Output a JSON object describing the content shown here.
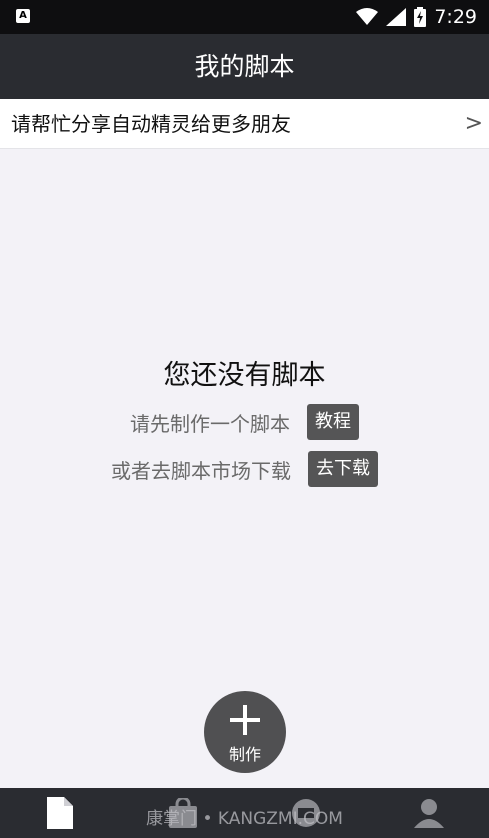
{
  "status_bar": {
    "time": "7:29",
    "app_badge": "A"
  },
  "header": {
    "title": "我的脚本"
  },
  "share_banner": {
    "label": "请帮忙分享自动精灵给更多朋友",
    "chevron": ">"
  },
  "empty_state": {
    "title": "您还没有脚本",
    "line1_text": "请先制作一个脚本",
    "line1_button": "教程",
    "line2_text": "或者去脚本市场下载",
    "line2_button": "去下载"
  },
  "fab": {
    "label": "制作"
  },
  "bottom_nav": {
    "items": [
      {
        "icon": "document-icon"
      },
      {
        "icon": "shopping-bag-icon"
      },
      {
        "icon": "message-icon"
      },
      {
        "icon": "person-icon"
      }
    ]
  },
  "watermark": "康掌门 • KANGZMI.COM",
  "colors": {
    "header_bg": "#2a2c31",
    "page_bg": "#f3f2f7",
    "button_bg": "#555556"
  }
}
